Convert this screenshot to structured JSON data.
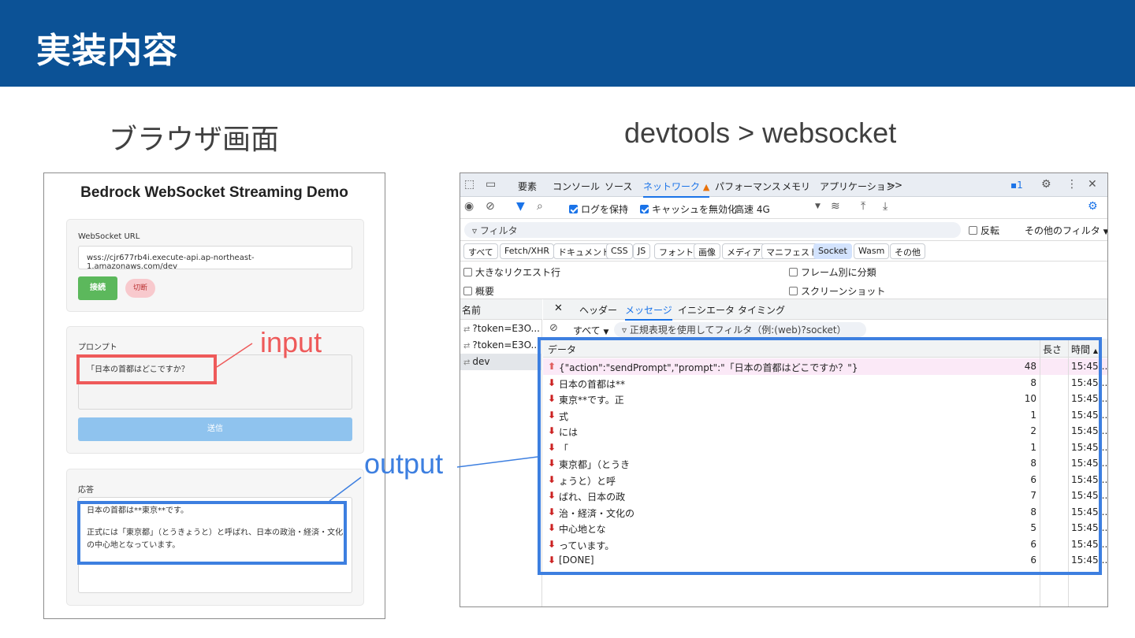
{
  "header": {
    "title": "実装内容"
  },
  "labels": {
    "browser": "ブラウザ画面",
    "devtools": "devtools > websocket"
  },
  "browser": {
    "title": "Bedrock WebSocket Streaming Demo",
    "ws_label": "WebSocket URL",
    "ws_url": "wss://cjr677rb4i.execute-api.ap-northeast-1.amazonaws.com/dev",
    "connect_label": "接続",
    "disconnect_label": "切断",
    "prompt_label": "プロンプト",
    "prompt_value": "「日本の首都はどこですか？",
    "send_label": "送信",
    "response_label": "応答",
    "response_line1": "日本の首都は**東京**です。",
    "response_line2": "正式には「東京都」（とうきょうと）と呼ばれ、日本の政治・経済・文化",
    "response_line3": "の中心地となっています。"
  },
  "annotations": {
    "input": "input",
    "output": "output"
  },
  "colors": {
    "header": "#0c5296",
    "input_highlight": "#ee5a5a",
    "output_highlight": "#3d7fe0"
  },
  "devtools": {
    "tabs": [
      "要素",
      "コンソール",
      "ソース",
      "ネットワーク",
      "パフォーマンス",
      "メモリ",
      "アプリケーション",
      ">>"
    ],
    "badge": "1",
    "preserve_log": "ログを保持",
    "disable_cache": "キャッシュを無効化",
    "throttle": "高速 4G",
    "filter_placeholder": "フィルタ",
    "invert": "反転",
    "more_filters": "その他のフィルタ",
    "types": [
      "すべて",
      "Fetch/XHR",
      "ドキュメント",
      "CSS",
      "JS",
      "フォント",
      "画像",
      "メディア",
      "マニフェスト",
      "Socket",
      "Wasm",
      "その他"
    ],
    "opt_big_rows": "大きなリクエスト行",
    "opt_group_frame": "フレーム別に分類",
    "opt_overview": "概要",
    "opt_screenshot": "スクリーンショット",
    "col_name": "名前",
    "requests": [
      "?token=E3O...",
      "?token=E3O...",
      "dev"
    ],
    "subtabs": [
      "ヘッダー",
      "メッセージ",
      "イニシエータ",
      "タイミング"
    ],
    "msg_filter_all": "すべて",
    "msg_filter_placeholder": "正規表現を使用してフィルタ（例:(web)?socket）",
    "col_data": "データ",
    "col_length": "長さ",
    "col_time": "時間",
    "messages": [
      {
        "dir": "up",
        "data": "{\"action\":\"sendPrompt\",\"prompt\":\"「日本の首都はどこですか？\"}",
        "length": "48",
        "time": "15:45:..."
      },
      {
        "dir": "down",
        "data": "日本の首都は**",
        "length": "8",
        "time": "15:45:..."
      },
      {
        "dir": "down",
        "data": "東京**です。正",
        "length": "10",
        "time": "15:45:..."
      },
      {
        "dir": "down",
        "data": "式",
        "length": "1",
        "time": "15:45:..."
      },
      {
        "dir": "down",
        "data": "には",
        "length": "2",
        "time": "15:45:..."
      },
      {
        "dir": "down",
        "data": "「",
        "length": "1",
        "time": "15:45:..."
      },
      {
        "dir": "down",
        "data": "東京都」（とうき",
        "length": "8",
        "time": "15:45:..."
      },
      {
        "dir": "down",
        "data": "ょうと）と呼",
        "length": "6",
        "time": "15:45:..."
      },
      {
        "dir": "down",
        "data": "ばれ、日本の政",
        "length": "7",
        "time": "15:45:..."
      },
      {
        "dir": "down",
        "data": "治・経済・文化の",
        "length": "8",
        "time": "15:45:..."
      },
      {
        "dir": "down",
        "data": "中心地とな",
        "length": "5",
        "time": "15:45:..."
      },
      {
        "dir": "down",
        "data": "っています。",
        "length": "6",
        "time": "15:45:..."
      },
      {
        "dir": "down",
        "data": "[DONE]",
        "length": "6",
        "time": "15:45:..."
      }
    ]
  }
}
